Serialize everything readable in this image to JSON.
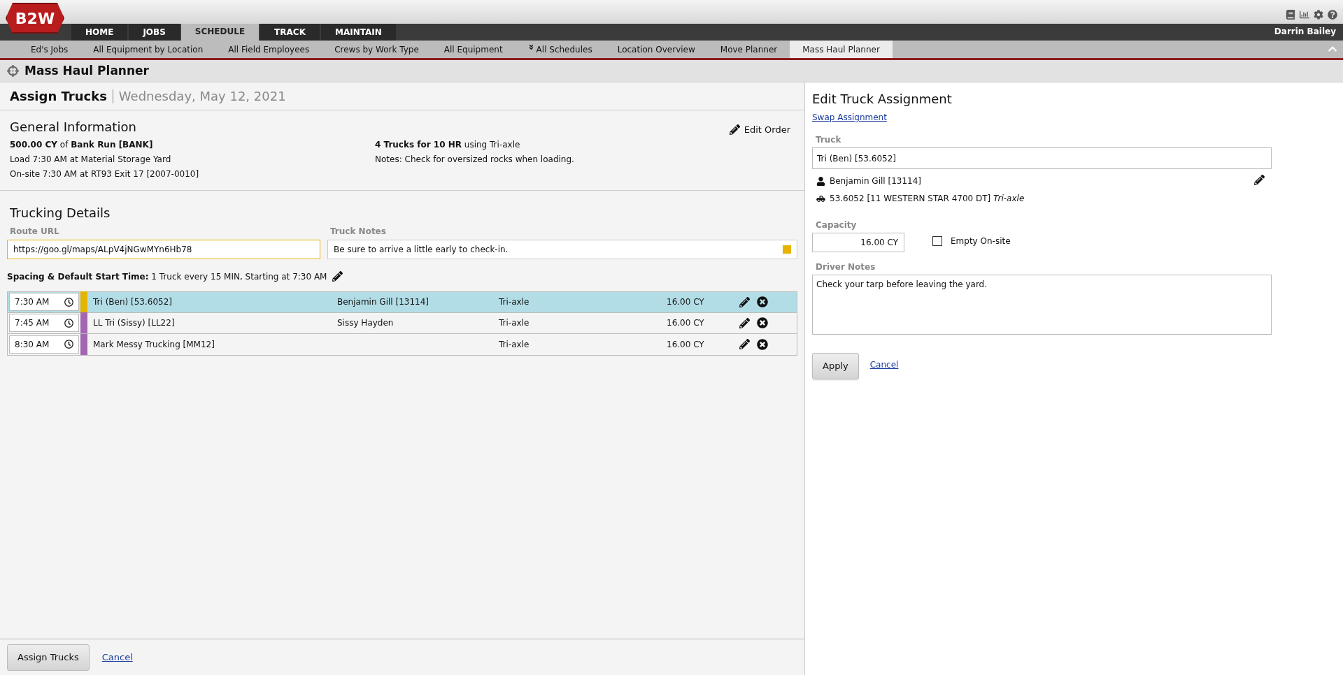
{
  "header": {
    "logo": "B2W",
    "user": "Darrin Bailey"
  },
  "main_tabs": [
    {
      "label": "HOME",
      "selected": false
    },
    {
      "label": "JOBS",
      "selected": false
    },
    {
      "label": "SCHEDULE",
      "selected": true
    },
    {
      "label": "TRACK",
      "selected": false
    },
    {
      "label": "MAINTAIN",
      "selected": false
    }
  ],
  "sub_tabs": [
    {
      "label": "Ed's Jobs",
      "selected": false
    },
    {
      "label": "All Equipment by Location",
      "selected": false
    },
    {
      "label": "All Field Employees",
      "selected": false
    },
    {
      "label": "Crews by Work Type",
      "selected": false
    },
    {
      "label": "All Equipment",
      "selected": false
    },
    {
      "label": "All Schedules",
      "selected": false,
      "kind": "dropdown"
    },
    {
      "label": "Location Overview",
      "selected": false
    },
    {
      "label": "Move Planner",
      "selected": false
    },
    {
      "label": "Mass Haul Planner",
      "selected": true
    }
  ],
  "page_title": "Mass Haul Planner",
  "assign": {
    "title": "Assign Trucks",
    "date": "Wednesday, May 12, 2021"
  },
  "general": {
    "title": "General Information",
    "edit": "Edit Order",
    "left": [
      "**500.00 CY** of **Bank Run [BANK]**",
      "Load 7:30 AM at Material Storage Yard",
      "On-site 7:30 AM at RT93 Exit 17 [2007-0010]"
    ],
    "right": [
      "**4 Trucks for 10 HR** using Tri-axle",
      "Notes: Check for oversized rocks when loading."
    ]
  },
  "trucking": {
    "title": "Trucking Details",
    "route_label": "Route URL",
    "route_value": "https://goo.gl/maps/ALpV4jNGwMYn6Hb78",
    "notes_label": "Truck Notes",
    "notes_value": "Be sure to arrive a little early to check-in.",
    "spacing": "**Spacing & Default Start Time:** 1 Truck every 15 MIN, Starting at 7:30 AM"
  },
  "rows": [
    {
      "time": "7:30 AM",
      "truck": "Tri (Ben) [53.6052]",
      "driver": "Benjamin Gill [13114]",
      "type": "Tri-axle",
      "capacity": "16.00 CY",
      "color": "#e6b400",
      "selected": true
    },
    {
      "time": "7:45 AM",
      "truck": "LL Tri (Sissy) [LL22]",
      "driver": "Sissy Hayden",
      "type": "Tri-axle",
      "capacity": "16.00 CY",
      "color": "#a366b3",
      "selected": false
    },
    {
      "time": "8:30 AM",
      "truck": "Mark Messy Trucking [MM12]",
      "driver": "",
      "type": "Tri-axle",
      "capacity": "16.00 CY",
      "color": "#a366b3",
      "selected": false
    }
  ],
  "edit_panel": {
    "title": "Edit Truck Assignment",
    "swap": "Swap Assignment",
    "truck_label": "Truck",
    "truck_value": "Tri (Ben) [53.6052]",
    "driver": "Benjamin Gill [13114]",
    "equipment": "53.6052 [11 WESTERN STAR 4700 DT] *Tri-axle*",
    "capacity_label": "Capacity",
    "capacity_value": "16.00 CY",
    "empty_onsite": {
      "label": "Empty On-site",
      "checked": false
    },
    "notes_label": "Driver Notes",
    "notes_value": "Check your tarp before leaving the yard.",
    "apply": "Apply",
    "cancel": "Cancel"
  },
  "footer": {
    "assign": "Assign Trucks",
    "cancel": "Cancel"
  }
}
